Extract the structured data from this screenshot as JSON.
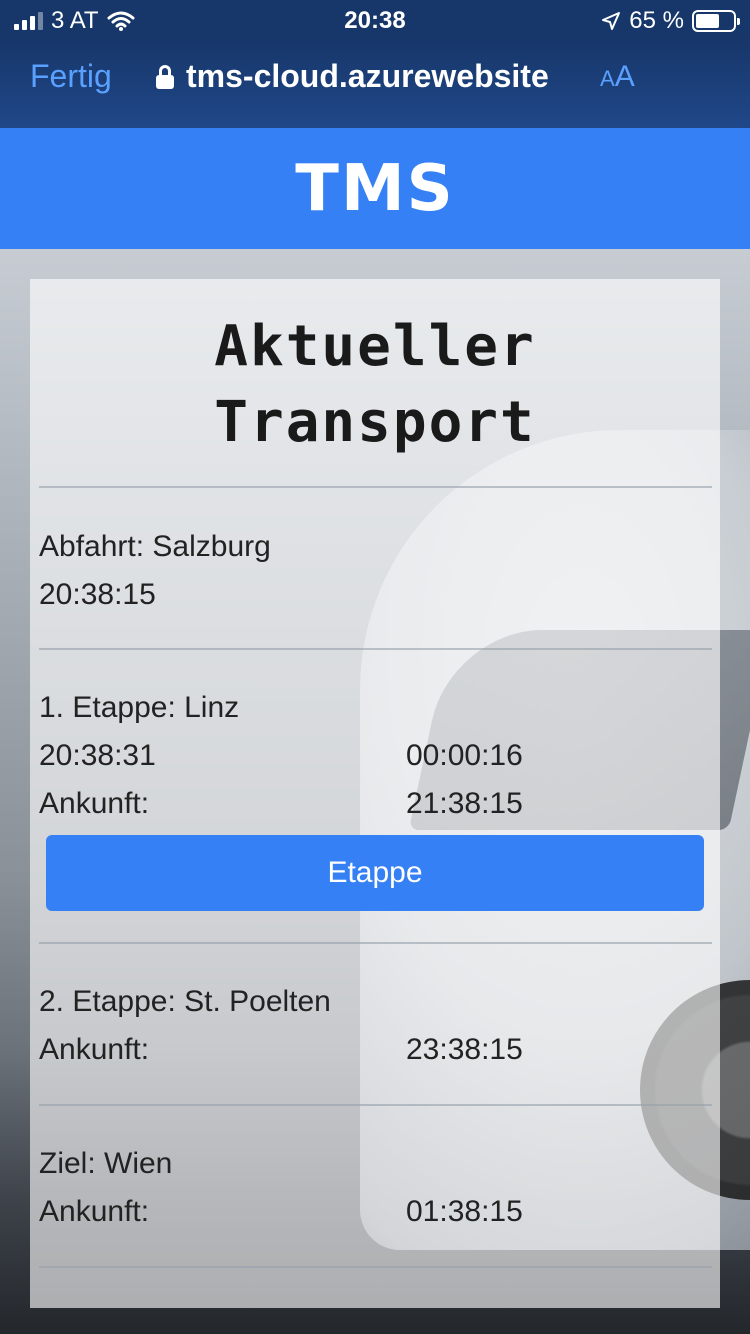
{
  "statusbar": {
    "carrier": "3 AT",
    "time": "20:38",
    "battery": "65 %",
    "battery_level": 0.65
  },
  "browser": {
    "done_label": "Fertig",
    "url": "tms-cloud.azurewebsite",
    "text_size_label_small": "A",
    "text_size_label_large": "A"
  },
  "header": {
    "logo": "TMS"
  },
  "card": {
    "title_line1": "Aktueller",
    "title_line2": "Transport",
    "departure": {
      "label": "Abfahrt: Salzburg",
      "time": "20:38:15"
    },
    "stage1": {
      "label": "1. Etappe: Linz",
      "time": "20:38:31",
      "elapsed": "00:00:16",
      "arrival_label": "Ankunft:",
      "arrival_time": "21:38:15",
      "button_label": "Etappe"
    },
    "stage2": {
      "label": "2. Etappe: St. Poelten",
      "arrival_label": "Ankunft:",
      "arrival_time": "23:38:15"
    },
    "destination": {
      "label": "Ziel: Wien",
      "arrival_label": "Ankunft:",
      "arrival_time": "01:38:15"
    }
  }
}
